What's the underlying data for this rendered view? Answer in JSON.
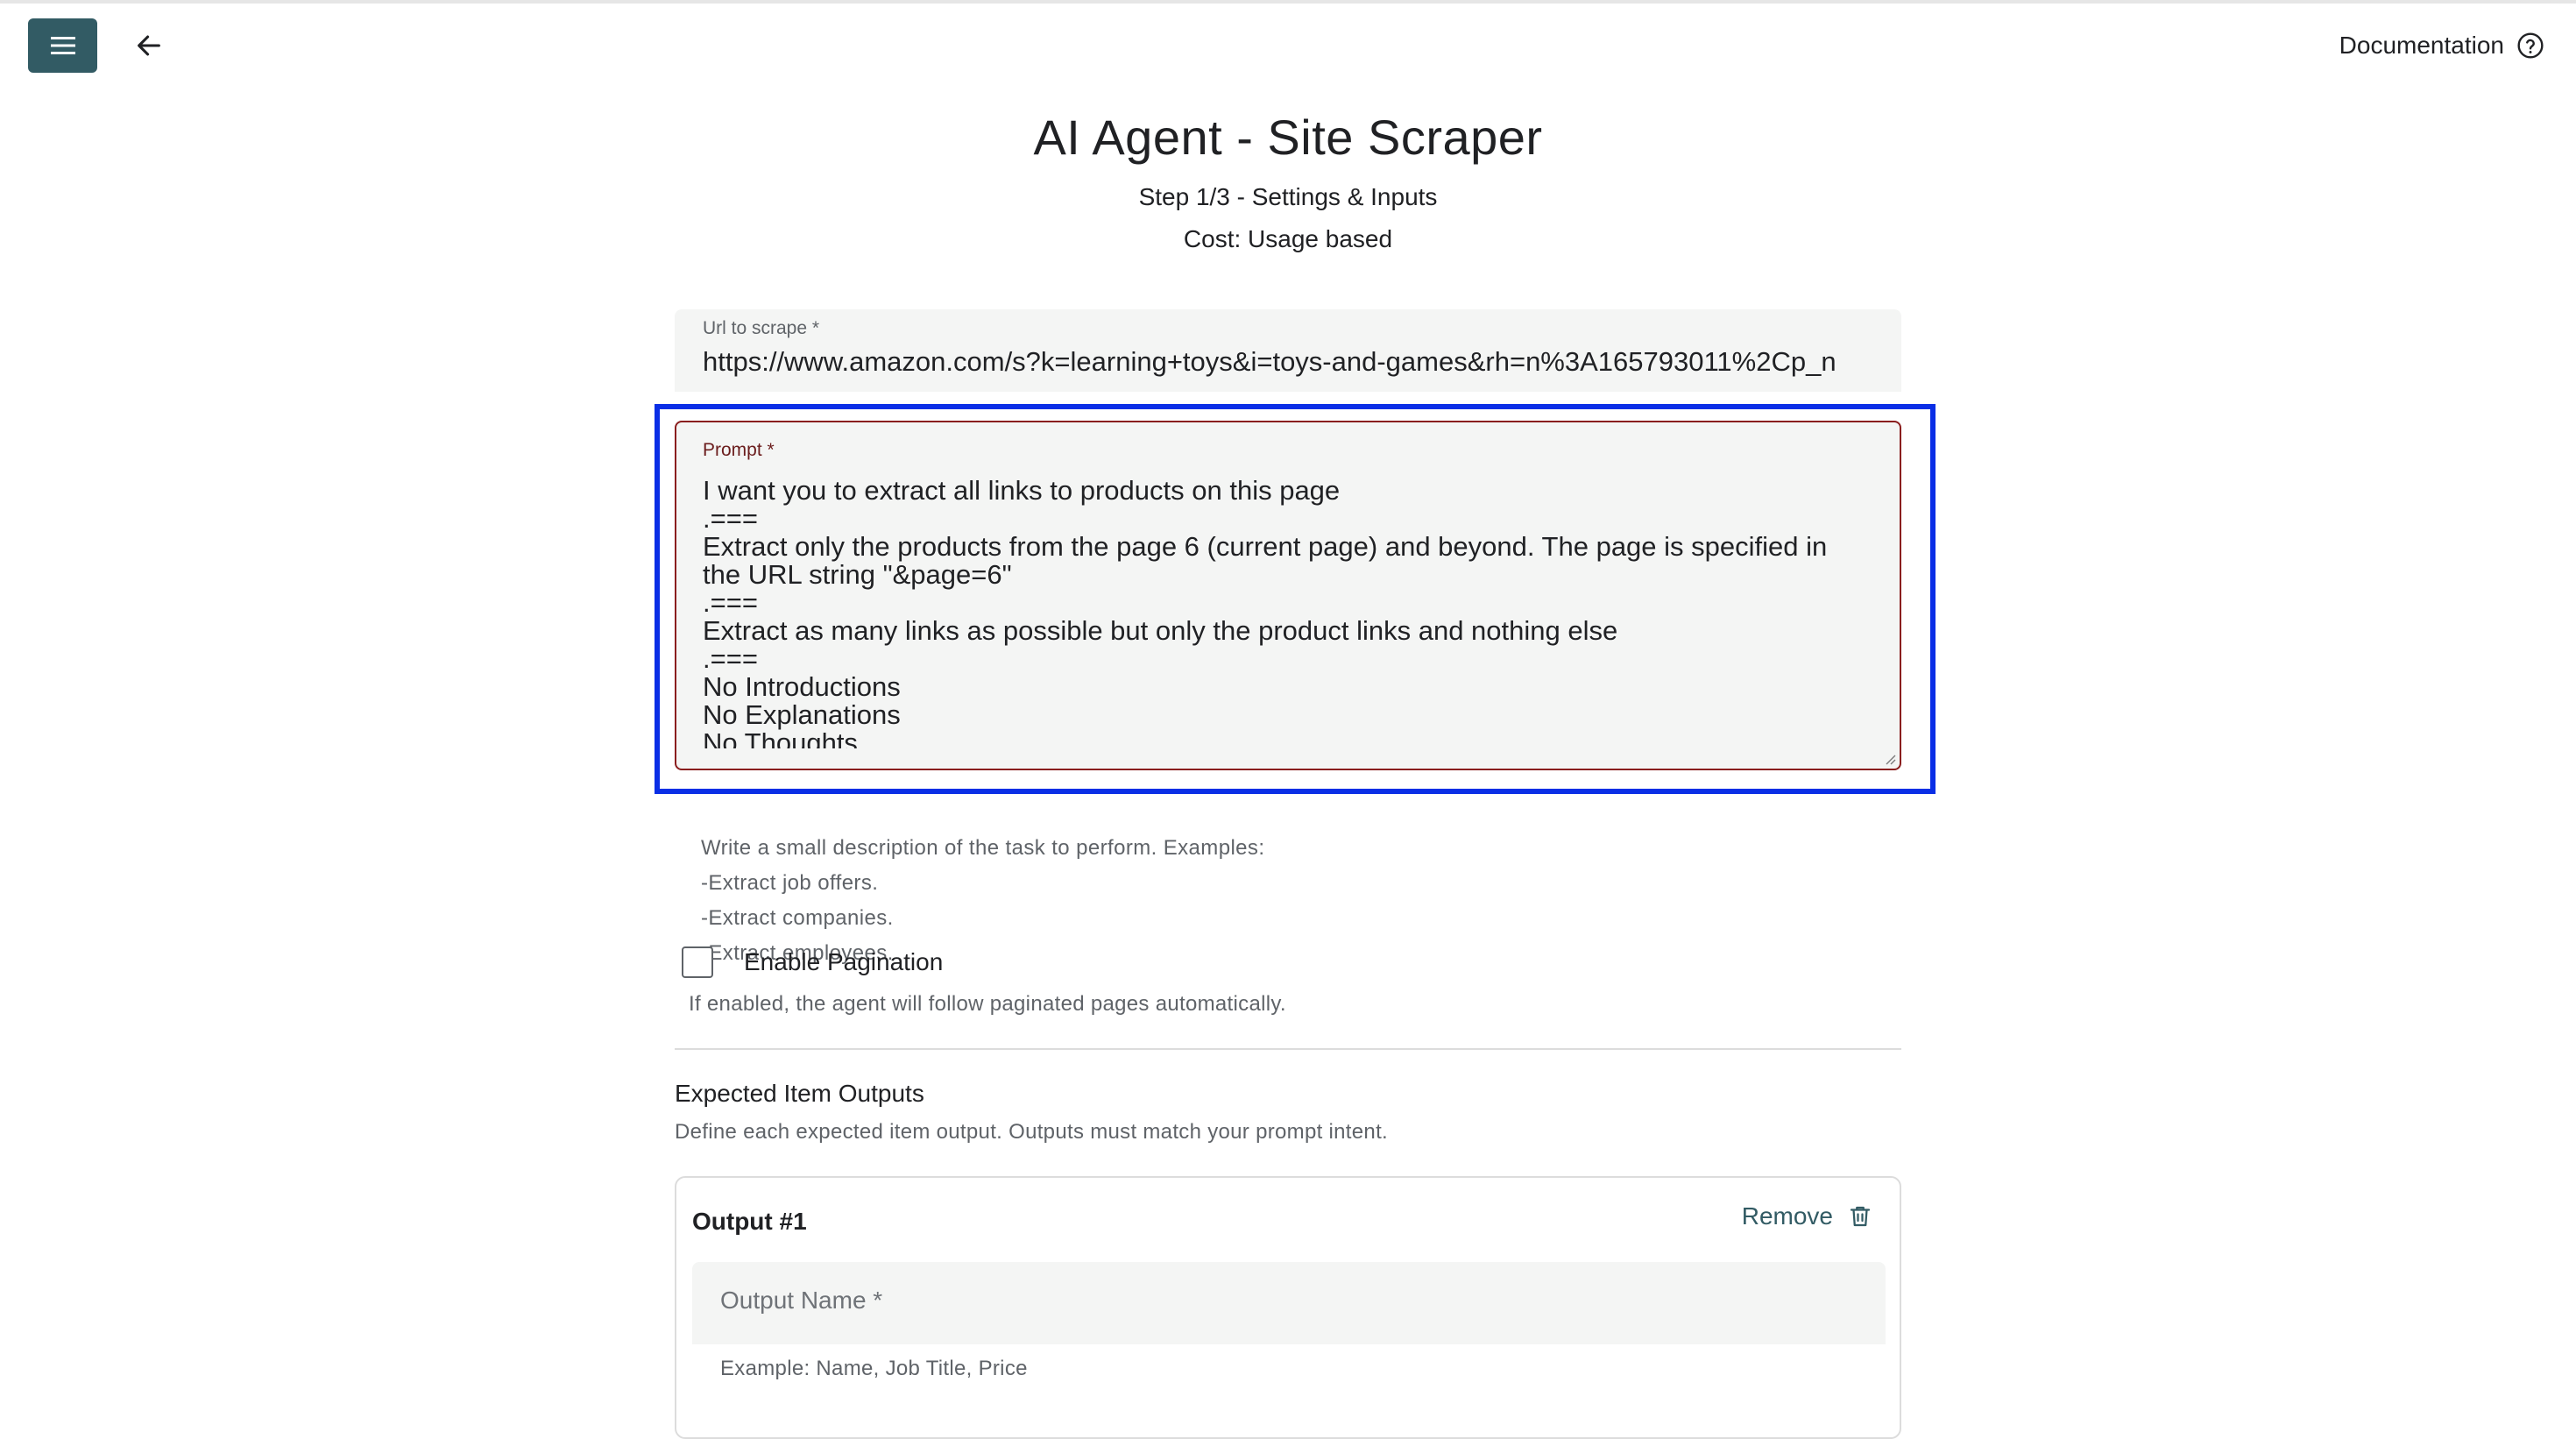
{
  "header": {
    "documentation_label": "Documentation",
    "accent_color": "#325b64"
  },
  "page": {
    "title": "AI Agent - Site Scraper",
    "step": "Step 1/3 - Settings & Inputs",
    "cost": "Cost: Usage based"
  },
  "url_field": {
    "label": "Url to scrape *",
    "value": "https://www.amazon.com/s?k=learning+toys&i=toys-and-games&rh=n%3A165793011%2Cp_n"
  },
  "prompt_field": {
    "label": "Prompt *",
    "value": "I want you to extract all links to products on this page\n.===\nExtract only the products from the page 6 (current page) and beyond. The page is specified in the URL string \"&page=6\"\n.===\nExtract as many links as possible but only the product links and nothing else\n.===\nNo Introductions\nNo Explanations\nNo Thoughts",
    "border_color": "#8a1e1e",
    "highlight_color": "#0a2ee6"
  },
  "prompt_hint": {
    "line_0": "Write a small description of the task to perform. Examples:",
    "line_1": "-Extract job offers.",
    "line_2": "-Extract companies.",
    "line_3": "-Extract employees."
  },
  "pagination": {
    "label": "Enable Pagination",
    "checked": false,
    "hint": "If enabled, the agent will follow paginated pages automatically."
  },
  "outputs_section": {
    "title": "Expected Item Outputs",
    "description": "Define each expected item output. Outputs must match your prompt intent.",
    "items": [
      {
        "title": "Output #1",
        "remove_label": "Remove",
        "name_placeholder": "Output Name *",
        "name_value": "",
        "hint": "Example: Name, Job Title, Price"
      }
    ]
  },
  "icons": {
    "menu": "hamburger-menu-icon",
    "back": "arrow-left-icon",
    "help": "help-circle-icon",
    "remove": "trash-icon"
  }
}
